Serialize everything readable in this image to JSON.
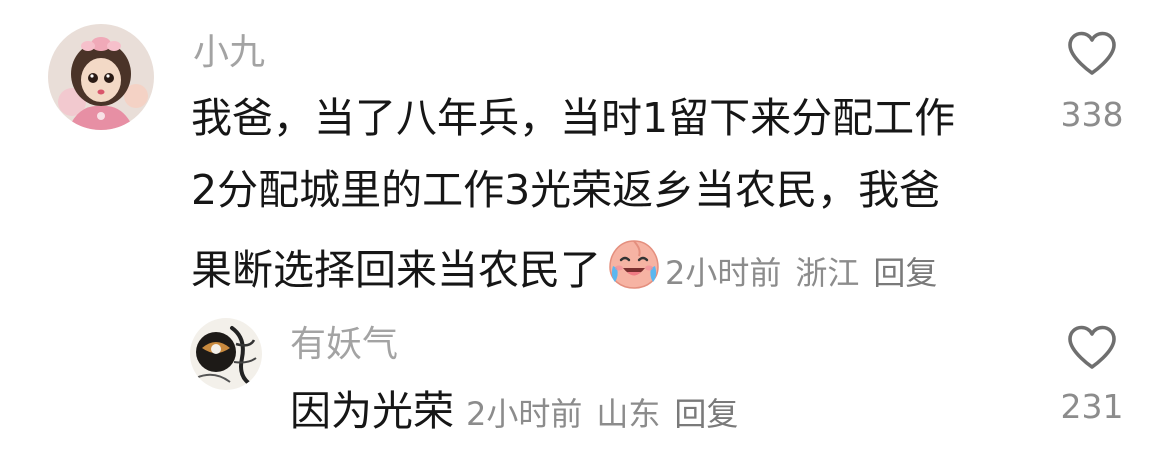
{
  "comments": [
    {
      "username": "小九",
      "text_lines": [
        "我爸，当了八年兵，当时1留下来分配工作",
        "2分配城里的工作3光荣返乡当农民，我爸",
        "果断选择回来当农民了"
      ],
      "emoji_icon": "laughing-crying-peach-face-icon",
      "time": "2小时前",
      "location": "浙江",
      "reply_label": "回复",
      "likes": "338"
    },
    {
      "username": "有妖气",
      "text": "因为光荣",
      "time": "2小时前",
      "location": "山东",
      "reply_label": "回复",
      "likes": "231"
    }
  ],
  "colors": {
    "username": "#a3a3a3",
    "text": "#161616",
    "meta": "#8c8c8c",
    "heart_outline": "#6f6f6f"
  }
}
